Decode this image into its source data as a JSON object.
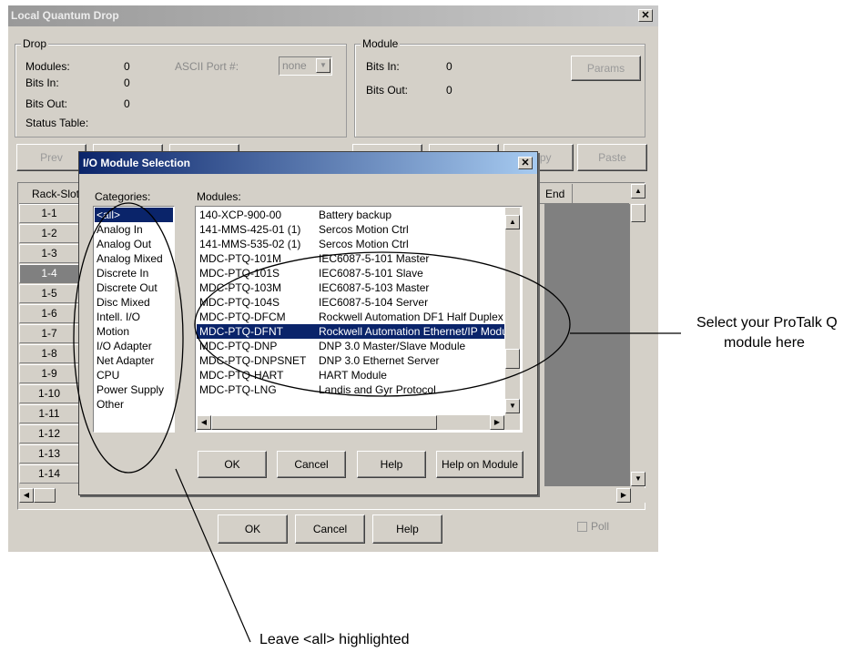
{
  "window": {
    "title": "Local Quantum Drop"
  },
  "drop": {
    "legend": "Drop",
    "modules_label": "Modules:",
    "modules_value": "0",
    "bits_in_label": "Bits In:",
    "bits_in_value": "0",
    "bits_out_label": "Bits Out:",
    "bits_out_value": "0",
    "status_table_label": "Status Table:",
    "ascii_port_label": "ASCII Port #:",
    "ascii_port_value": "none"
  },
  "module": {
    "legend": "Module",
    "bits_in_label": "Bits In:",
    "bits_in_value": "0",
    "bits_out_label": "Bits Out:",
    "bits_out_value": "0",
    "params_label": "Params"
  },
  "toolbar": {
    "prev_label": "Prev",
    "copy_label": "Copy",
    "paste_label": "Paste"
  },
  "grid": {
    "rack_slot_header": "Rack-Slot",
    "end_header": "End",
    "rows": [
      "1-1",
      "1-2",
      "1-3",
      "1-4",
      "1-5",
      "1-6",
      "1-7",
      "1-8",
      "1-9",
      "1-10",
      "1-11",
      "1-12",
      "1-13",
      "1-14"
    ],
    "selected_row": "1-4"
  },
  "main_buttons": {
    "ok": "OK",
    "cancel": "Cancel",
    "help": "Help",
    "poll_label": "Poll"
  },
  "dialog": {
    "title": "I/O Module Selection",
    "categories_label": "Categories:",
    "categories": [
      "<all>",
      "Analog In",
      "Analog Out",
      "Analog Mixed",
      "Discrete In",
      "Discrete Out",
      "Disc Mixed",
      "Intell. I/O",
      "Motion",
      "I/O Adapter",
      "Net Adapter",
      "CPU",
      "Power Supply",
      "Other"
    ],
    "selected_category": "<all>",
    "modules_label": "Modules:",
    "modules": [
      {
        "code": "140-XCP-900-00",
        "desc": "Battery backup"
      },
      {
        "code": "141-MMS-425-01 (1)",
        "desc": "Sercos Motion Ctrl"
      },
      {
        "code": "141-MMS-535-02 (1)",
        "desc": "Sercos Motion Ctrl"
      },
      {
        "code": "MDC-PTQ-101M",
        "desc": "IEC6087-5-101 Master"
      },
      {
        "code": "MDC-PTQ-101S",
        "desc": "IEC6087-5-101 Slave"
      },
      {
        "code": "MDC-PTQ-103M",
        "desc": "IEC6087-5-103 Master"
      },
      {
        "code": "MDC-PTQ-104S",
        "desc": "IEC6087-5-104 Server"
      },
      {
        "code": "MDC-PTQ-DFCM",
        "desc": "Rockwell Automation DF1 Half Duplex"
      },
      {
        "code": "MDC-PTQ-DFNT",
        "desc": "Rockwell Automation Ethernet/IP Module"
      },
      {
        "code": "MDC-PTQ-DNP",
        "desc": "DNP 3.0 Master/Slave Module"
      },
      {
        "code": "MDC-PTQ-DNPSNET",
        "desc": "DNP 3.0 Ethernet Server"
      },
      {
        "code": "MDC-PTQ-HART",
        "desc": "HART Module"
      },
      {
        "code": "MDC-PTQ-LNG",
        "desc": "Landis and Gyr Protocol"
      }
    ],
    "selected_module": "MDC-PTQ-DFNT",
    "ok": "OK",
    "cancel": "Cancel",
    "help": "Help",
    "help_on_module": "Help on Module"
  },
  "annotations": {
    "select_line1": "Select your ProTalk Q",
    "select_line2": "module here",
    "leave": "Leave <all> highlighted"
  }
}
